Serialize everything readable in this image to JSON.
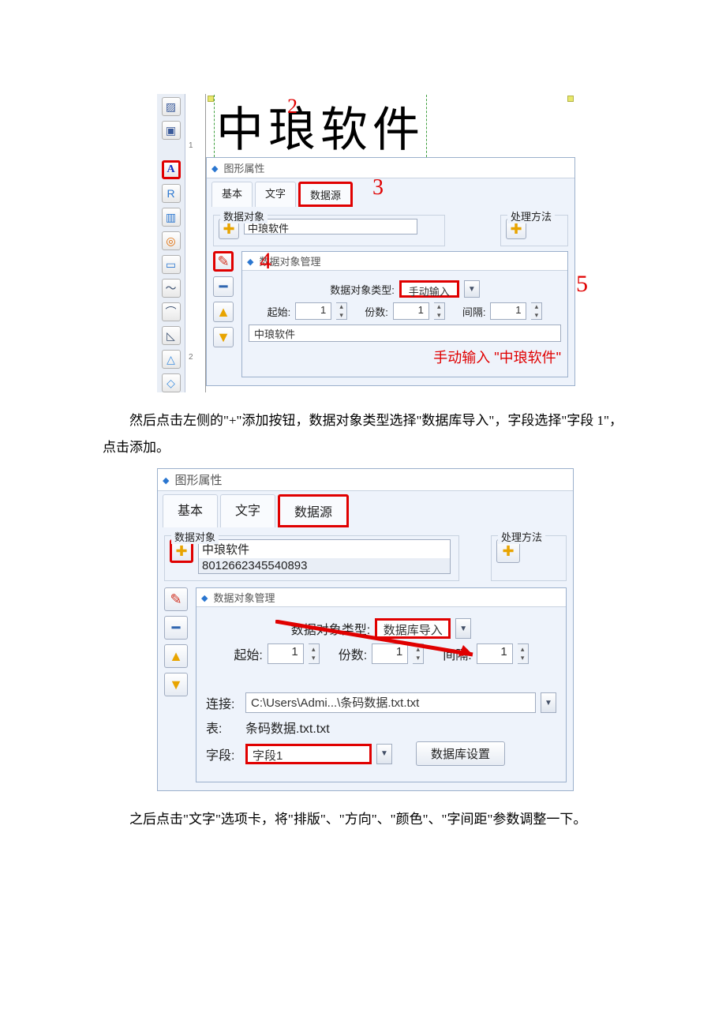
{
  "screenshot1": {
    "canvas_text": "中琅软件",
    "annotation_1": "1",
    "annotation_2": "2",
    "annotation_3": "3",
    "annotation_4": "4",
    "annotation_5": "5",
    "panel_title": "图形属性",
    "tabs": {
      "basic": "基本",
      "text": "文字",
      "datasource": "数据源"
    },
    "group_data_obj": "数据对象",
    "group_method": "处理方法",
    "list_item": "中琅软件",
    "sub_panel_title": "数据对象管理",
    "label_type": "数据对象类型:",
    "type_value": "手动输入",
    "label_start": "起始:",
    "start_value": "1",
    "label_count": "份数:",
    "count_value": "1",
    "label_interval": "间隔:",
    "interval_value": "1",
    "preview_value": "中琅软件",
    "red_note": "手动输入 \"中琅软件\""
  },
  "para1": "然后点击左侧的\"+\"添加按钮，数据对象类型选择\"数据库导入\"，字段选择\"字段 1\"，点击添加。",
  "screenshot2": {
    "panel_title": "图形属性",
    "tabs": {
      "basic": "基本",
      "text": "文字",
      "datasource": "数据源"
    },
    "group_data_obj": "数据对象",
    "group_method": "处理方法",
    "list_item1": "中琅软件",
    "list_item2": "8012662345540893",
    "sub_panel_title": "数据对象管理",
    "label_type": "数据对象类型:",
    "type_value": "数据库导入",
    "label_start": "起始:",
    "start_value": "1",
    "label_count": "份数:",
    "count_value": "1",
    "label_interval": "间隔:",
    "interval_value": "1",
    "label_conn": "连接:",
    "conn_value": "C:\\Users\\Admi...\\条码数据.txt.txt",
    "label_table": "表:",
    "table_value": "条码数据.txt.txt",
    "label_field": "字段:",
    "field_value": "字段1",
    "btn_dbset": "数据库设置"
  },
  "para2": "之后点击\"文字\"选项卡，将\"排版\"、\"方向\"、\"颜色\"、\"字间距\"参数调整一下。"
}
